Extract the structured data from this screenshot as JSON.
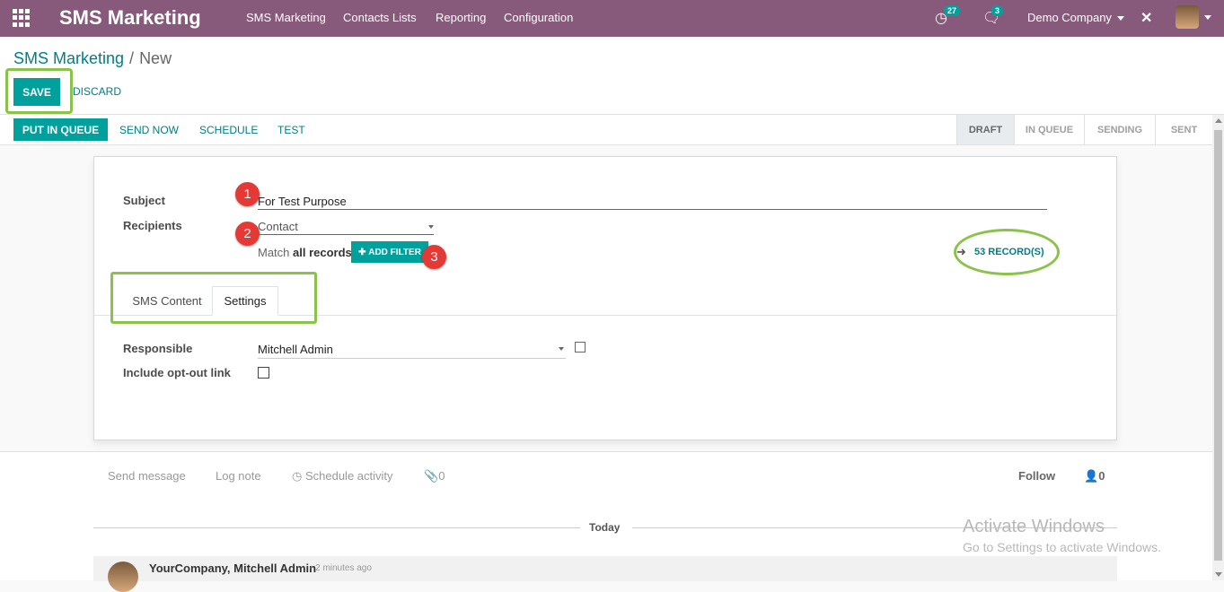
{
  "topbar": {
    "brand": "SMS Marketing",
    "menu": [
      "SMS Marketing",
      "Contacts Lists",
      "Reporting",
      "Configuration"
    ],
    "activity_count": "27",
    "message_count": "3",
    "company": "Demo Company"
  },
  "breadcrumb": {
    "parent": "SMS Marketing",
    "current": "New"
  },
  "buttons": {
    "save": "SAVE",
    "discard": "DISCARD",
    "put_in_queue": "PUT IN QUEUE",
    "send_now": "SEND NOW",
    "schedule": "SCHEDULE",
    "test": "TEST"
  },
  "stages": [
    "DRAFT",
    "IN QUEUE",
    "SENDING",
    "SENT"
  ],
  "form": {
    "subject_label": "Subject",
    "subject_value": "For Test Purpose",
    "recipients_label": "Recipients",
    "recipients_value": "Contact",
    "match_text": "Match",
    "match_bold": "all records",
    "add_filter": "ADD FILTER",
    "records_link": "53 RECORD(S)",
    "tabs": [
      "SMS Content",
      "Settings"
    ],
    "responsible_label": "Responsible",
    "responsible_value": "Mitchell Admin",
    "optout_label": "Include opt-out link"
  },
  "annotations": [
    "1",
    "2",
    "3"
  ],
  "chatter": {
    "send_message": "Send message",
    "log_note": "Log note",
    "schedule_activity": "Schedule activity",
    "attachments": "0",
    "follow": "Follow",
    "followers": "0",
    "today": "Today",
    "message_author": "YourCompany, Mitchell Admin",
    "message_time": "- 2 minutes ago"
  },
  "watermark": {
    "line1": "Activate Windows",
    "line2": "Go to Settings to activate Windows."
  },
  "colors": {
    "topbar": "#875a7b",
    "primary": "#00a09d",
    "highlight": "#8bc34a",
    "marker": "#e53935"
  }
}
